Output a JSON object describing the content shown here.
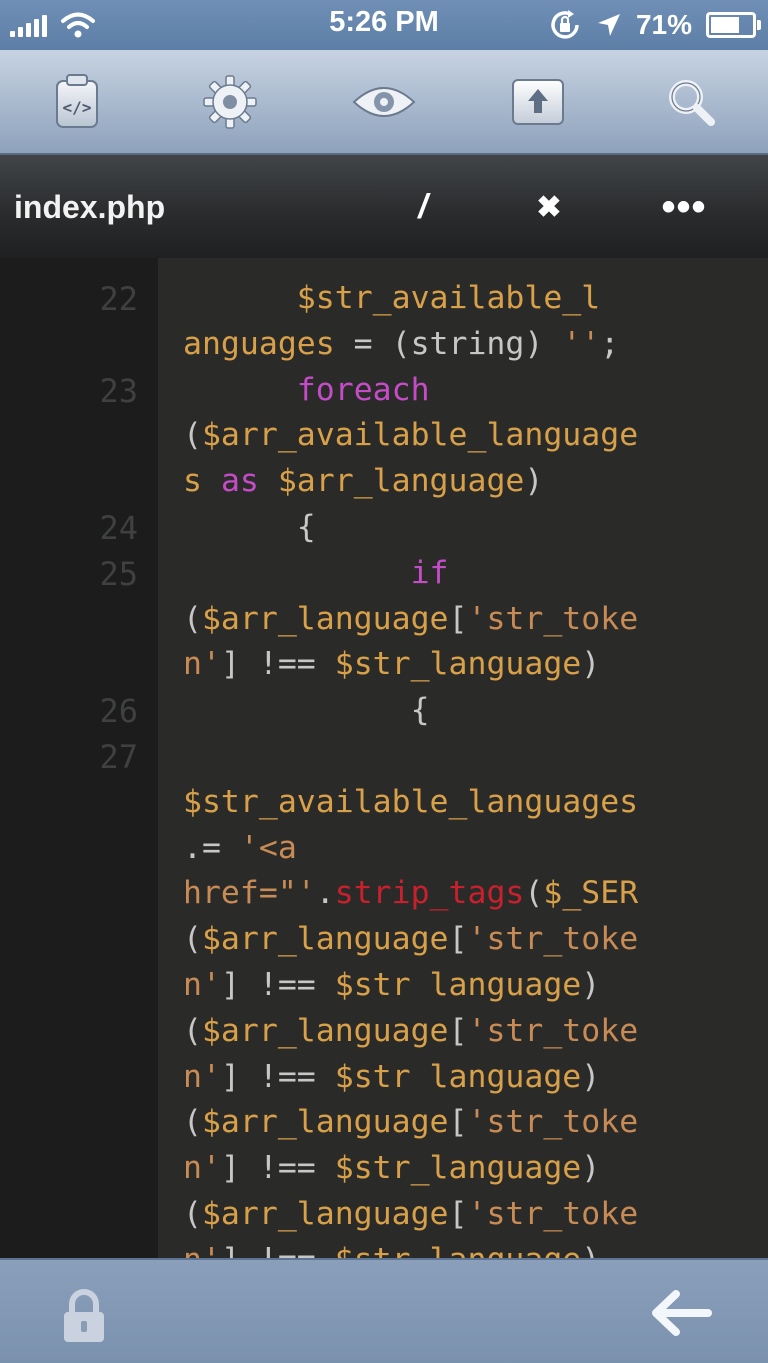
{
  "status_bar": {
    "time": "5:26 PM",
    "battery_percent": "71%",
    "battery_level": 0.71,
    "icons": [
      "signal-icon",
      "wifi-icon",
      "rotation-lock-icon",
      "location-icon",
      "battery-icon"
    ]
  },
  "toolbar": {
    "buttons": [
      {
        "name": "file-code-button",
        "icon": "file-code-icon"
      },
      {
        "name": "settings-button",
        "icon": "gear-icon"
      },
      {
        "name": "preview-button",
        "icon": "eye-icon"
      },
      {
        "name": "upload-button",
        "icon": "upload-icon"
      },
      {
        "name": "search-button",
        "icon": "search-icon"
      }
    ]
  },
  "file_bar": {
    "filename": "index.php",
    "slash_label": "/",
    "close_label": "✖",
    "more_label": "•••"
  },
  "editor": {
    "gutter_lines": [
      {
        "n": "22",
        "row": 0
      },
      {
        "n": "23",
        "row": 2
      },
      {
        "n": "24",
        "row": 5
      },
      {
        "n": "25",
        "row": 6
      },
      {
        "n": "26",
        "row": 9
      },
      {
        "n": "27",
        "row": 10
      }
    ],
    "code_lines": [
      [
        [
          "      ",
          "op"
        ],
        [
          "$str_available_l",
          "var"
        ]
      ],
      [
        [
          "anguages",
          "var"
        ],
        [
          " = (",
          "op"
        ],
        [
          "string",
          "op"
        ],
        [
          ") ",
          "op"
        ],
        [
          "''",
          "str"
        ],
        [
          ";",
          "op"
        ]
      ],
      [
        [
          "      ",
          "op"
        ],
        [
          "foreach",
          "kw"
        ]
      ],
      [
        [
          "(",
          "op"
        ],
        [
          "$arr_available_language",
          "var"
        ]
      ],
      [
        [
          "s ",
          "var"
        ],
        [
          "as ",
          "kw"
        ],
        [
          "$arr_language",
          "var"
        ],
        [
          ")",
          "op"
        ]
      ],
      [
        [
          "      {",
          "op"
        ]
      ],
      [
        [
          "            ",
          "op"
        ],
        [
          "if",
          "kw"
        ]
      ],
      [
        [
          "(",
          "op"
        ],
        [
          "$arr_language",
          "var"
        ],
        [
          "[",
          "op"
        ],
        [
          "'str_toke",
          "str"
        ]
      ],
      [
        [
          "n'",
          "str"
        ],
        [
          "] !== ",
          "op"
        ],
        [
          "$str_language",
          "var"
        ],
        [
          ")",
          "op"
        ]
      ],
      [
        [
          "            {",
          "op"
        ]
      ],
      [
        [
          "",
          "op"
        ]
      ],
      [
        [
          "$str_available_languages",
          "var"
        ]
      ],
      [
        [
          ".= ",
          "op"
        ],
        [
          "'<a",
          "str"
        ]
      ],
      [
        [
          "href=\"'",
          "str"
        ],
        [
          ".",
          "op"
        ],
        [
          "strip_tags",
          "fn"
        ],
        [
          "(",
          "op"
        ],
        [
          "$_SER",
          "var"
        ]
      ],
      [
        [
          "(",
          "op"
        ],
        [
          "$arr_language",
          "var"
        ],
        [
          "[",
          "op"
        ],
        [
          "'str_toke",
          "str"
        ]
      ],
      [
        [
          "n'",
          "str"
        ],
        [
          "] !== ",
          "op"
        ],
        [
          "$str language",
          "var"
        ],
        [
          ")",
          "op"
        ]
      ],
      [
        [
          "(",
          "op"
        ],
        [
          "$arr_language",
          "var"
        ],
        [
          "[",
          "op"
        ],
        [
          "'str_toke",
          "str"
        ]
      ],
      [
        [
          "n'",
          "str"
        ],
        [
          "] !== ",
          "op"
        ],
        [
          "$str language",
          "var"
        ],
        [
          ")",
          "op"
        ]
      ],
      [
        [
          "(",
          "op"
        ],
        [
          "$arr_language",
          "var"
        ],
        [
          "[",
          "op"
        ],
        [
          "'str_toke",
          "str"
        ]
      ],
      [
        [
          "n'",
          "str"
        ],
        [
          "] !== ",
          "op"
        ],
        [
          "$str_language",
          "var"
        ],
        [
          ")",
          "op"
        ]
      ],
      [
        [
          "(",
          "op"
        ],
        [
          "$arr_language",
          "var"
        ],
        [
          "[",
          "op"
        ],
        [
          "'str_toke",
          "str"
        ]
      ],
      [
        [
          "n'",
          "str"
        ],
        [
          "] !== ",
          "op"
        ],
        [
          "$str language",
          "var"
        ],
        [
          ")",
          "op"
        ]
      ]
    ]
  },
  "bottom_bar": {
    "icons": [
      "lock-icon",
      "back-arrow-icon"
    ]
  }
}
